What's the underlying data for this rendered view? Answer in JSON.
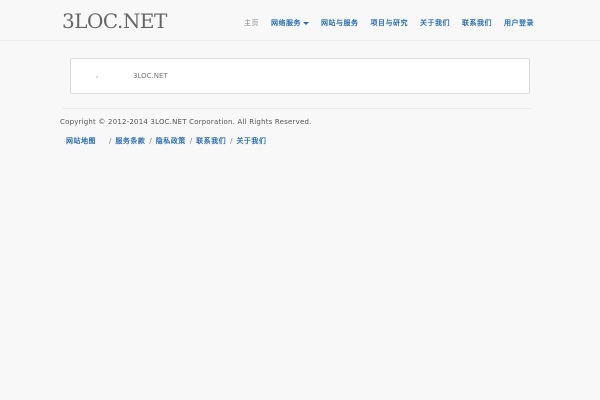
{
  "header": {
    "brand": "3LOC.NET",
    "nav": [
      {
        "label": "主页",
        "active": true
      },
      {
        "label": "网络服务",
        "dropdown": true
      },
      {
        "label": "网站与服务"
      },
      {
        "label": "项目与研究"
      },
      {
        "label": "关于我们"
      },
      {
        "label": "联系我们"
      },
      {
        "label": "用户登录"
      }
    ]
  },
  "panel": {
    "comma": ",",
    "site": "3LOC.NET"
  },
  "footer": {
    "copyright": "Copyright © 2012-2014 3LOC.NET Corporation. All Rights Reserved.",
    "links": [
      "网站地图",
      "服务条款",
      "隐私政策",
      "联系我们",
      "关于我们"
    ]
  }
}
